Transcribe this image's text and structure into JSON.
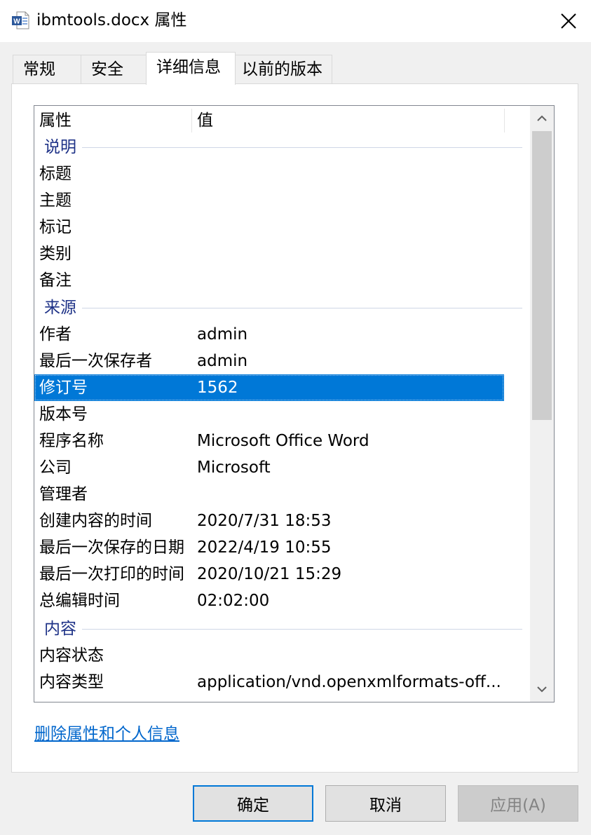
{
  "window": {
    "title": "ibmtools.docx 属性",
    "icon": "word-document-icon",
    "close_icon": "close-icon"
  },
  "tabs": [
    {
      "label": "常规",
      "active": false
    },
    {
      "label": "安全",
      "active": false
    },
    {
      "label": "详细信息",
      "active": true
    },
    {
      "label": "以前的版本",
      "active": false
    }
  ],
  "list": {
    "columns": [
      "属性",
      "值"
    ],
    "rows": [
      {
        "type": "group",
        "label": "说明"
      },
      {
        "key": "标题",
        "value": ""
      },
      {
        "key": "主题",
        "value": ""
      },
      {
        "key": "标记",
        "value": ""
      },
      {
        "key": "类别",
        "value": ""
      },
      {
        "key": "备注",
        "value": ""
      },
      {
        "type": "group",
        "label": "来源"
      },
      {
        "key": "作者",
        "value": "admin"
      },
      {
        "key": "最后一次保存者",
        "value": "admin"
      },
      {
        "key": "修订号",
        "value": "1562",
        "selected": true
      },
      {
        "key": "版本号",
        "value": ""
      },
      {
        "key": "程序名称",
        "value": "Microsoft Office Word"
      },
      {
        "key": "公司",
        "value": "Microsoft"
      },
      {
        "key": "管理者",
        "value": ""
      },
      {
        "key": "创建内容的时间",
        "value": "2020/7/31 18:53"
      },
      {
        "key": "最后一次保存的日期",
        "value": "2022/4/19 10:55"
      },
      {
        "key": "最后一次打印的时间",
        "value": "2020/10/21 15:29"
      },
      {
        "key": "总编辑时间",
        "value": "02:02:00"
      },
      {
        "type": "group",
        "label": "内容"
      },
      {
        "key": "内容状态",
        "value": ""
      },
      {
        "key": "内容类型",
        "value": "application/vnd.openxmlformats-off..."
      }
    ],
    "scroll_up_icon": "chevron-up-icon",
    "scroll_down_icon": "chevron-down-icon"
  },
  "remove_link": "删除属性和个人信息",
  "buttons": {
    "ok": "确定",
    "cancel": "取消",
    "apply": "应用(A)"
  },
  "colors": {
    "selection": "#0078d7",
    "group_header": "#1e3287",
    "link": "#0066cc"
  }
}
